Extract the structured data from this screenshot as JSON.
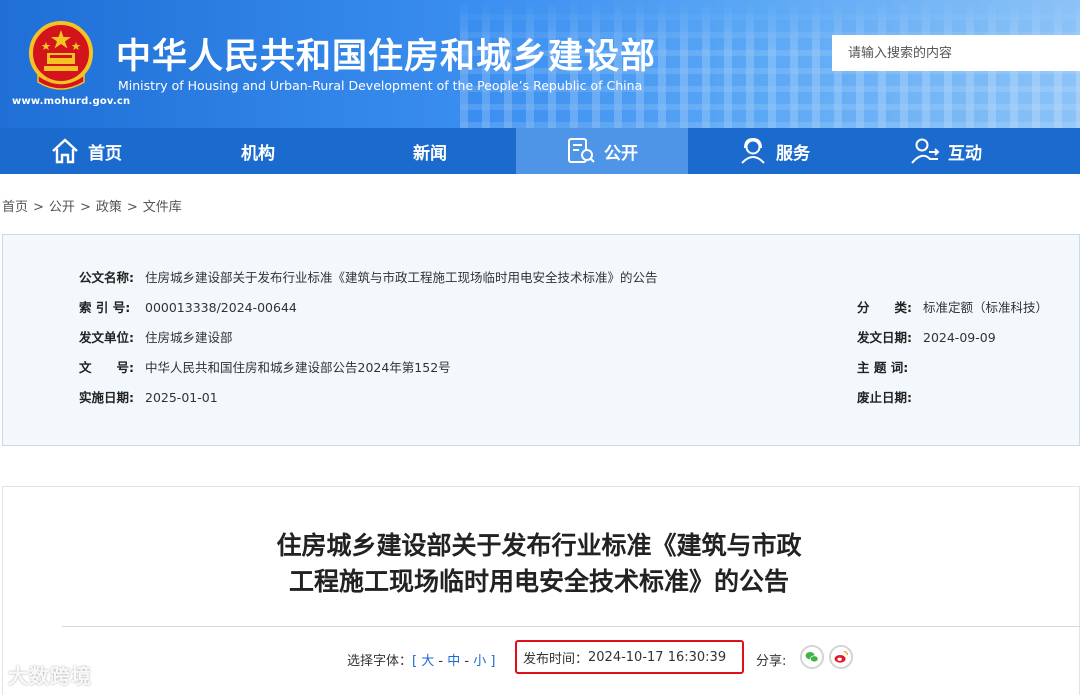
{
  "header": {
    "title_cn": "中华人民共和国住房和城乡建设部",
    "title_en": "Ministry of Housing and Urban-Rural Development of the People’s Republic of China",
    "site_url": "www.mohurd.gov.cn",
    "search_placeholder": "请输入搜索的内容"
  },
  "nav": [
    {
      "label": "首页",
      "icon": "home-icon"
    },
    {
      "label": "机构",
      "icon": ""
    },
    {
      "label": "新闻",
      "icon": ""
    },
    {
      "label": "公开",
      "icon": "document-icon",
      "active": true
    },
    {
      "label": "服务",
      "icon": "user-service-icon"
    },
    {
      "label": "互动",
      "icon": "interaction-icon"
    }
  ],
  "breadcrumb": [
    "首页",
    "公开",
    "政策",
    "文件库"
  ],
  "info": {
    "doc_name_label": "公文名称:",
    "doc_name": "住房城乡建设部关于发布行业标准《建筑与市政工程施工现场临时用电安全技术标准》的公告",
    "index_label": "索 引 号:",
    "index": "000013338/2024-00644",
    "category_label": "分　　类:",
    "category": "标准定额（标准科技）",
    "issuer_label": "发文单位:",
    "issuer": "住房城乡建设部",
    "issue_date_label": "发文日期:",
    "issue_date": "2024-09-09",
    "doc_no_label": "文　　号:",
    "doc_no": "中华人民共和国住房和城乡建设部公告2024年第152号",
    "keywords_label": "主 题 词:",
    "keywords": "",
    "effective_label": "实施日期:",
    "effective": "2025-01-01",
    "abolish_label": "废止日期:",
    "abolish": ""
  },
  "article": {
    "title_line1": "住房城乡建设部关于发布行业标准《建筑与市政",
    "title_line2": "工程施工现场临时用电安全技术标准》的公告",
    "font_label": "选择字体：",
    "font_open": "[",
    "font_large": "大",
    "font_medium": "中",
    "font_small": "小",
    "font_dash": "-",
    "font_close": "]",
    "publish_time_label": "发布时间：",
    "publish_time": "2024-10-17 16:30:39",
    "share_label": "分享:"
  },
  "watermark": "大数跨境",
  "colors": {
    "nav_bg": "#1b6bcf",
    "nav_active": "#4e95e8",
    "info_bg": "#f2f8fb",
    "highlight_border": "#e0101a"
  }
}
